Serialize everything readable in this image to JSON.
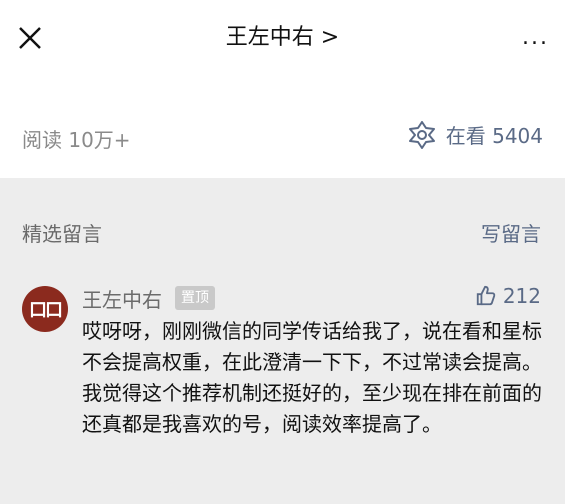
{
  "header": {
    "title": "王左中右 >",
    "more_label": "...",
    "close_icon": "close-icon"
  },
  "stats": {
    "read_label": "阅读 10万+",
    "looking_label": "在看 5404",
    "looking_icon": "looking-star-icon"
  },
  "comments_section": {
    "title": "精选留言",
    "write_label": "写留言"
  },
  "comment": {
    "avatar_text": "口口",
    "author": "王左中右",
    "pinned_label": "置顶",
    "likes": "212",
    "text": "哎呀呀，刚刚微信的同学传话给我了，说在看和星标不会提高权重，在此澄清一下下，不过常读会提高。我觉得这个推荐机制还挺好的，至少现在排在前面的还真都是我喜欢的号，阅读效率提高了。"
  }
}
